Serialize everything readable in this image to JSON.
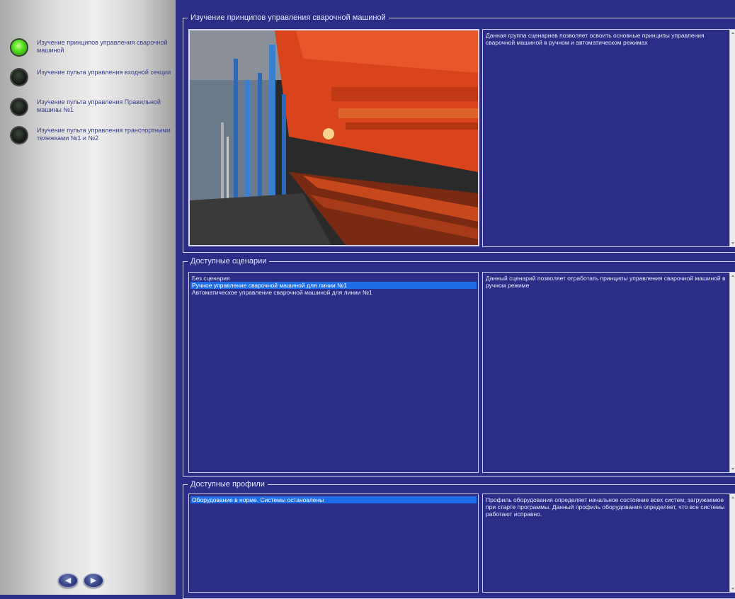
{
  "sidebar": {
    "items": [
      {
        "label": "Изучение принципов управления сварочной машиной",
        "active": true
      },
      {
        "label": "Изучение пульта управления входной секции",
        "active": false
      },
      {
        "label": "Изучение пульта управления Правильной машины №1",
        "active": false
      },
      {
        "label": "Изучение пульта управления транспортными тележками №1 и №2",
        "active": false
      }
    ],
    "prev_icon": "chevron-left-icon",
    "next_icon": "chevron-right-icon"
  },
  "group_main": {
    "title": "Изучение принципов управления сварочной машиной",
    "description": "Данная группа сценариев позволяет освоить основные принципы управления сварочной машиной в ручном и автоматическом режимах"
  },
  "scenarios": {
    "title": "Доступные сценарии",
    "items": [
      "Без сценария",
      "Ручное управление сварочной машиной для линии №1",
      "Автоматическое управление сварочной машиной для линии №1"
    ],
    "selected_index": 1,
    "description": "Данный сценарий позволяет отработать принципы управления сварочной машиной в ручном режиме"
  },
  "profiles": {
    "title": "Доступные профили",
    "items": [
      "Оборудование в норме. Системы остановлены"
    ],
    "selected_index": 0,
    "description": "Профиль оборудования определяет начальное состояние всех систем, загружаемое при старте программы. Данный профиль оборудования определяет, что все системы работают исправно."
  },
  "colors": {
    "background": "#2b2d86",
    "selection": "#1e6de8",
    "active_led": "#54e01f"
  }
}
